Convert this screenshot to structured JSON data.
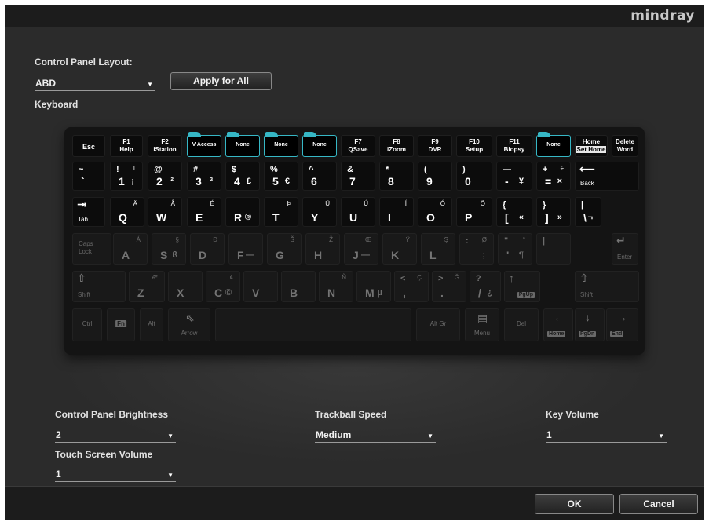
{
  "brand": "mindray",
  "control_panel_layout": {
    "label": "Control Panel Layout:",
    "value": "ABD",
    "apply_label": "Apply for All"
  },
  "keyboard_label": "Keyboard",
  "fkeys": {
    "esc": "Esc",
    "f1": {
      "top": "F1",
      "bottom": "Help"
    },
    "f2": {
      "top": "F2",
      "bottom": "iStation"
    },
    "c1": "V Access",
    "c2": "None",
    "c3": "None",
    "c4": "None",
    "f7": {
      "top": "F7",
      "bottom": "QSave"
    },
    "f8": {
      "top": "F8",
      "bottom": "iZoom"
    },
    "f9": {
      "top": "F9",
      "bottom": "DVR"
    },
    "f10": {
      "top": "F10",
      "bottom": "Setup"
    },
    "f11": {
      "top": "F11",
      "bottom": "Biopsy"
    },
    "c5": "None",
    "home": {
      "top": "Home",
      "bottom": "Set Home"
    },
    "delete": {
      "top": "Delete",
      "bottom": "Word"
    }
  },
  "row1": [
    {
      "tl": "~",
      "bl": "`"
    },
    {
      "tl": "!",
      "tr": "1",
      "bl": "1",
      "br": "¡"
    },
    {
      "tl": "@",
      "bl": "2",
      "br": "²"
    },
    {
      "tl": "#",
      "bl": "3",
      "br": "³"
    },
    {
      "tl": "$",
      "bl": "4",
      "br": "£"
    },
    {
      "tl": "%",
      "bl": "5",
      "br": "€"
    },
    {
      "tl": "^",
      "bl": "6"
    },
    {
      "tl": "&",
      "bl": "7"
    },
    {
      "tl": "*",
      "bl": "8"
    },
    {
      "tl": "(",
      "bl": "9"
    },
    {
      "tl": ")",
      "bl": "0"
    },
    {
      "tl": "—",
      "bl": "-",
      "br": "¥"
    },
    {
      "tl": "+",
      "tr": "÷",
      "bl": "=",
      "br": "×"
    },
    {
      "arrow": "⟵",
      "bl": "Back"
    }
  ],
  "row2": [
    {
      "arrow": "⇥",
      "bl": "Tab"
    },
    {
      "tr": "Ä",
      "bl": "Q"
    },
    {
      "tr": "Å",
      "bl": "W"
    },
    {
      "tr": "É",
      "bl": "E"
    },
    {
      "bl": "R",
      "br": "®"
    },
    {
      "tr": "Þ",
      "bl": "T"
    },
    {
      "tr": "Ü",
      "bl": "Y"
    },
    {
      "tr": "Ú",
      "bl": "U"
    },
    {
      "tr": "Í",
      "bl": "I"
    },
    {
      "tr": "Ó",
      "bl": "O"
    },
    {
      "tr": "Ö",
      "bl": "P"
    },
    {
      "tl": "{",
      "bl": "[",
      "br": "«"
    },
    {
      "tl": "}",
      "bl": "]",
      "br": "»"
    },
    {
      "tl": "|",
      "bl": "\\",
      "br": "¬"
    }
  ],
  "row3": [
    {
      "bl": "Caps",
      "bl2": "Lock"
    },
    {
      "tr": "Á",
      "bl": "A"
    },
    {
      "tr": "§",
      "bl": "S",
      "br": "ß"
    },
    {
      "tr": "Ð",
      "bl": "D"
    },
    {
      "bl": "F",
      "br": "—"
    },
    {
      "tr": "Š",
      "bl": "G"
    },
    {
      "tr": "Ž",
      "bl": "H"
    },
    {
      "tr": "Œ",
      "bl": "J",
      "br": "—"
    },
    {
      "tr": "Ÿ",
      "bl": "K"
    },
    {
      "tr": "Ş",
      "bl": "L"
    },
    {
      "tr": "Ø",
      "tl": ":",
      "br": ";"
    },
    {
      "tl": "\"",
      "tr": "°",
      "bl": "'",
      "br": "¶"
    },
    {
      "tl": "|"
    },
    {
      "arrow": "↵",
      "bl": "Enter"
    }
  ],
  "row4": [
    {
      "arrow": "⇧",
      "bl": "Shift"
    },
    {
      "tr": "Æ",
      "bl": "Z"
    },
    {
      "bl": "X"
    },
    {
      "tr": "¢",
      "bl": "C",
      "br": "©"
    },
    {
      "bl": "V"
    },
    {
      "bl": "B"
    },
    {
      "tr": "Ñ",
      "bl": "N"
    },
    {
      "bl": "M",
      "br": "µ"
    },
    {
      "tl": "<",
      "tr": "Ç",
      "bl": ","
    },
    {
      "tl": ">",
      "tr": "Ğ",
      "bl": "."
    },
    {
      "tl": "?",
      "bl": "/",
      "br": "¿"
    },
    {
      "arrow": "↑",
      "box": "PgUp"
    },
    {
      "arrow": "⇧",
      "bl": "Shift"
    }
  ],
  "row5": {
    "ctrl": "Ctrl",
    "fn": "Fn",
    "alt": "Alt",
    "arrow_key": "Arrow",
    "altgr": "Alt Gr",
    "menu": "Menu",
    "del": "Del",
    "home": "Home",
    "pgdn": "PgDn",
    "end": "End"
  },
  "settings": {
    "brightness": {
      "label": "Control Panel Brightness",
      "value": "2"
    },
    "trackball": {
      "label": "Trackball Speed",
      "value": "Medium"
    },
    "key_volume": {
      "label": "Key Volume",
      "value": "1"
    },
    "touch_volume": {
      "label": "Touch Screen Volume",
      "value": "1"
    }
  },
  "footer": {
    "ok": "OK",
    "cancel": "Cancel"
  },
  "colors": {
    "accent": "#36b7c5",
    "background": "#2b2b2b",
    "bar": "#1c1c1c"
  }
}
